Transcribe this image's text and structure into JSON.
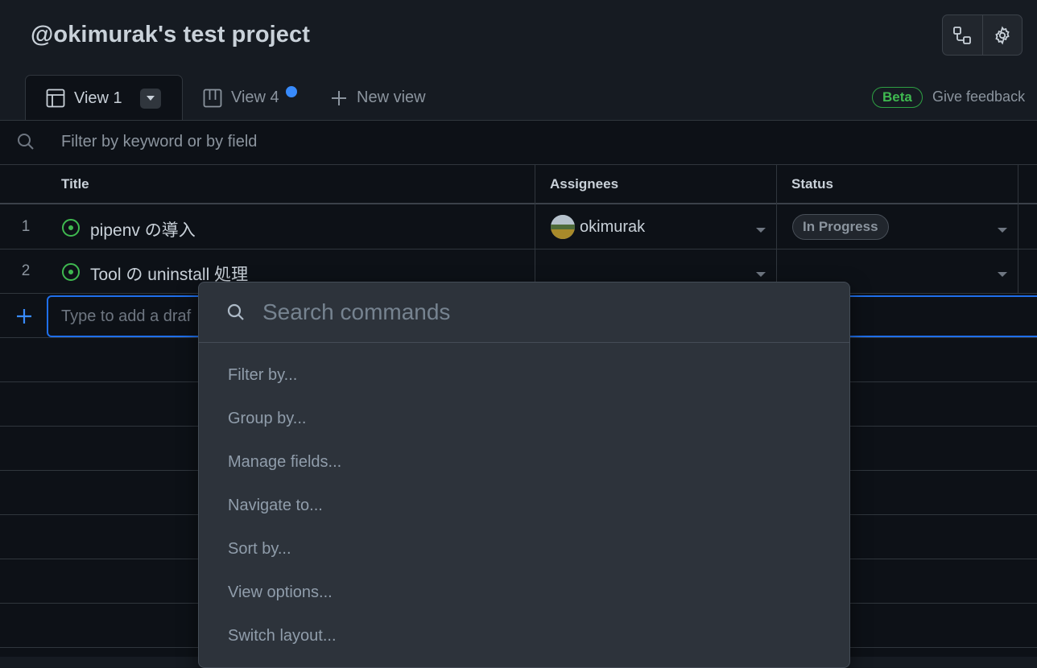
{
  "project": {
    "title": "@okimurak's test project"
  },
  "tabs": [
    {
      "label": "View 1",
      "active": true,
      "icon": "table-icon"
    },
    {
      "label": "View 4",
      "active": false,
      "icon": "board-icon",
      "has_unsaved_dot": true
    },
    {
      "label": "New view",
      "icon": "plus-icon"
    }
  ],
  "beta_badge": "Beta",
  "feedback_link": "Give feedback",
  "filter": {
    "placeholder": "Filter by keyword or by field"
  },
  "table": {
    "columns": [
      "Title",
      "Assignees",
      "Status"
    ],
    "rows": [
      {
        "num": "1",
        "title": "pipenv の導入",
        "assignee": "okimurak",
        "status": "In Progress"
      },
      {
        "num": "2",
        "title": "Tool の uninstall 処理",
        "assignee": "",
        "status": ""
      }
    ],
    "draft_placeholder": "Type to add a draf"
  },
  "command_palette": {
    "search_placeholder": "Search commands",
    "items": [
      "Filter by...",
      "Group by...",
      "Manage fields...",
      "Navigate to...",
      "Sort by...",
      "View options...",
      "Switch layout..."
    ]
  },
  "colors": {
    "background": "#0d1117",
    "header_bg": "#161b22",
    "accent_blue": "#388bfd",
    "open_green": "#3fb950"
  }
}
